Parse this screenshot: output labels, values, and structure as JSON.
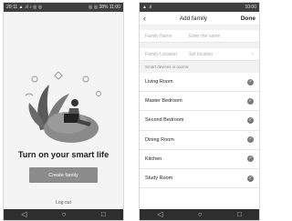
{
  "left": {
    "status": {
      "left": "20:11 ▲ .ıl ♪ ◎ ◎",
      "right": "◎ ◎ 38% 11:00"
    },
    "title": "Turn on your smart life",
    "create_button": "Create family",
    "logout": "Log out"
  },
  "right": {
    "status": {
      "left": "▲ .ıl",
      "right": "10:00"
    },
    "header": {
      "back": "‹",
      "title": "Add family",
      "done": "Done"
    },
    "fields": [
      {
        "label": "Family Name",
        "placeholder": "Enter the name",
        "chevron": ""
      },
      {
        "label": "Family Location",
        "placeholder": "Set location",
        "chevron": "›"
      }
    ],
    "section_label": "Smart devices in rooms:",
    "rooms": [
      "Living Room",
      "Master Bedroom",
      "Second Bedroom",
      "Dining Room",
      "Kitchen",
      "Study Room"
    ]
  },
  "nav": {
    "back": "◁",
    "home": "○",
    "recent": "□"
  },
  "colors": {
    "button_gray": "#8c8c8c",
    "status_bar": "#3f3f3f",
    "nav_bar": "#2e2e2e",
    "check": "#7a7a7a"
  }
}
